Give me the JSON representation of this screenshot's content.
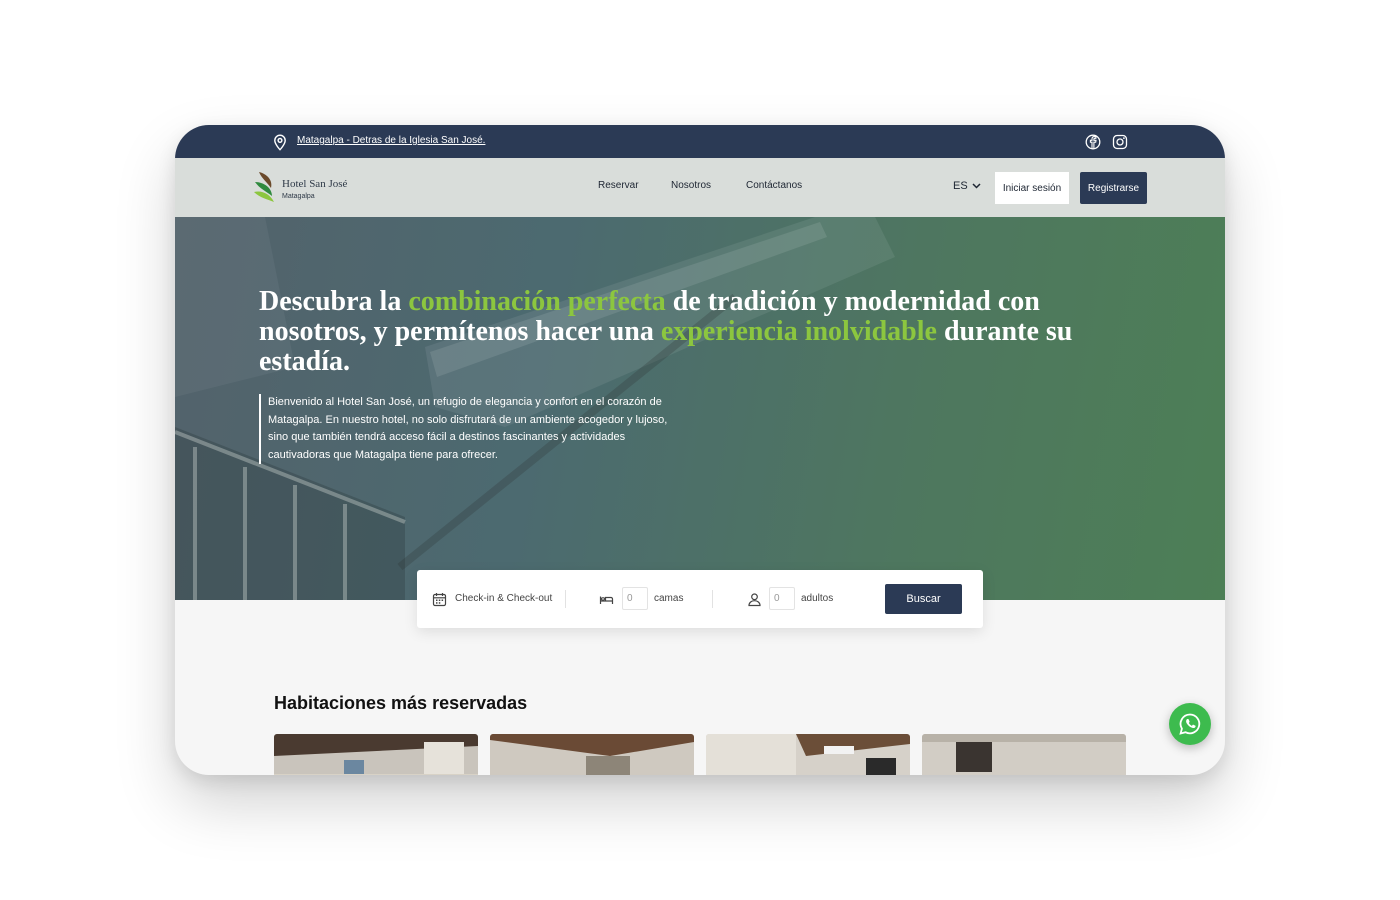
{
  "topbar": {
    "location_text": "Matagalpa - Detras de la Iglesia San José.",
    "social_icons": [
      "facebook-icon",
      "instagram-icon"
    ]
  },
  "brand": {
    "name": "Hotel San José",
    "subtitle": "Matagalpa"
  },
  "nav": {
    "links": [
      "Reservar",
      "Nosotros",
      "Contáctanos"
    ],
    "language": "ES",
    "login_label": "Iniciar sesión",
    "register_label": "Registrarse"
  },
  "hero": {
    "title_parts": [
      "Descubra la ",
      "combinación perfecta",
      " de tradición y modernidad con nosotros, y permítenos hacer una ",
      "experiencia inolvidable",
      " durante su estadía."
    ],
    "description": "Bienvenido al Hotel San José, un refugio de elegancia y confort en el corazón de Matagalpa. En nuestro hotel, no solo disfrutará de un ambiente acogedor y lujoso, sino que también tendrá acceso fácil a destinos fascinantes y actividades cautivadoras que Matagalpa tiene para ofrecer."
  },
  "search": {
    "dates_label": "Check-in & Check-out",
    "beds_value": "0",
    "beds_label": "camas",
    "adults_value": "0",
    "adults_label": "adultos",
    "button_label": "Buscar"
  },
  "rooms_section": {
    "title": "Habitaciones más reservadas",
    "card_count_visible": 4
  },
  "colors": {
    "navy": "#2b3a55",
    "accent_green": "#8cc63f",
    "whatsapp_green": "#3dbb4e"
  }
}
